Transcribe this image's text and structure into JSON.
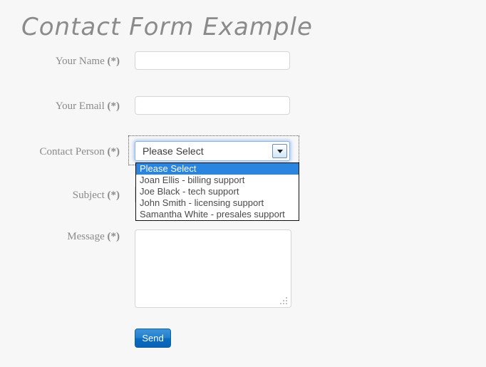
{
  "page": {
    "title": "Contact Form Example",
    "background_color": "#f7f7f7",
    "title_color": "#8b8b8b",
    "accent_color": "#2a85e0"
  },
  "form": {
    "fields": [
      {
        "name": "your-name",
        "label": "Your Name",
        "required_marker": "(*)",
        "type": "text",
        "value": "",
        "placeholder": ""
      },
      {
        "name": "your-email",
        "label": "Your Email",
        "required_marker": "(*)",
        "type": "text",
        "value": "",
        "placeholder": ""
      },
      {
        "name": "contact-person",
        "label": "Contact Person",
        "required_marker": "(*)",
        "type": "select",
        "value": "Please Select"
      },
      {
        "name": "subject",
        "label": "Subject",
        "required_marker": "(*)",
        "type": "text",
        "value": "",
        "placeholder": ""
      },
      {
        "name": "message",
        "label": "Message",
        "required_marker": "(*)",
        "type": "textarea",
        "value": "",
        "placeholder": ""
      }
    ],
    "contact_person_select": {
      "selected_value": "Please Select",
      "expanded": true,
      "arrow_icon": "chevron-down-icon",
      "options": [
        {
          "label": "Please Select",
          "highlighted": true
        },
        {
          "label": "Joan Ellis - billing support",
          "highlighted": false
        },
        {
          "label": "Joe Black - tech support",
          "highlighted": false
        },
        {
          "label": "John Smith - licensing support",
          "highlighted": false
        },
        {
          "label": "Samantha White - presales support",
          "highlighted": false
        }
      ]
    },
    "submit": {
      "label": "Send"
    }
  }
}
